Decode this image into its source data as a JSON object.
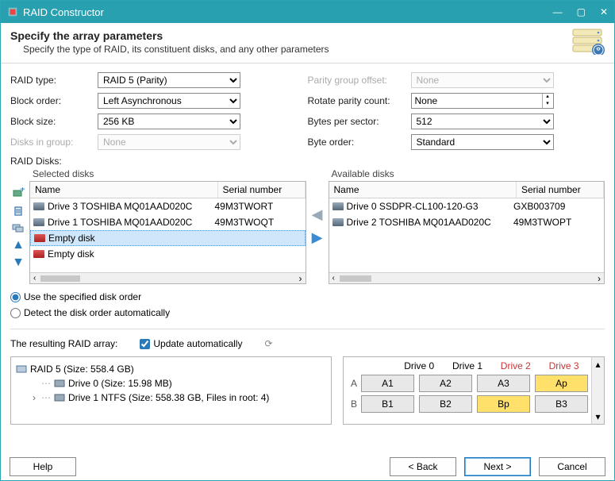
{
  "window": {
    "title": "RAID Constructor"
  },
  "header": {
    "title": "Specify the array parameters",
    "subtitle": "Specify the type of RAID, its constituent disks, and any other parameters"
  },
  "left_form": {
    "raid_type": {
      "label": "RAID type:",
      "value": "RAID 5 (Parity)"
    },
    "block_order": {
      "label": "Block order:",
      "value": "Left Asynchronous"
    },
    "block_size": {
      "label": "Block size:",
      "value": "256 KB"
    },
    "disks_in_group": {
      "label": "Disks in group:",
      "value": "None"
    }
  },
  "right_form": {
    "parity_offset": {
      "label": "Parity group offset:",
      "value": "None"
    },
    "rotate_parity": {
      "label": "Rotate parity count:",
      "value": "None"
    },
    "bytes_sector": {
      "label": "Bytes per sector:",
      "value": "512"
    },
    "byte_order": {
      "label": "Byte order:",
      "value": "Standard"
    }
  },
  "raid_disks_label": "RAID Disks:",
  "selected_title": "Selected disks",
  "available_title": "Available disks",
  "col_name": "Name",
  "col_serial": "Serial number",
  "selected": [
    {
      "name": "Drive 3 TOSHIBA MQ01AAD020C",
      "serial": "49M3TWORT",
      "icon": "disk"
    },
    {
      "name": "Drive 1 TOSHIBA MQ01AAD020C",
      "serial": "49M3TWOQT",
      "icon": "disk"
    },
    {
      "name": "Empty disk",
      "serial": "",
      "icon": "warn"
    },
    {
      "name": "Empty disk",
      "serial": "",
      "icon": "warn"
    }
  ],
  "available": [
    {
      "name": "Drive 0 SSDPR-CL100-120-G3",
      "serial": "GXB003709"
    },
    {
      "name": "Drive 2 TOSHIBA MQ01AAD020C",
      "serial": "49M3TWOPT"
    }
  ],
  "radios": {
    "specified": "Use the specified disk order",
    "auto": "Detect the disk order automatically"
  },
  "result_label": "The resulting RAID array:",
  "update_auto": "Update automatically",
  "tree": {
    "root": "RAID 5 (Size: 558.4 GB)",
    "c1": "Drive 0 (Size: 15.98 MB)",
    "c2": "Drive 1 NTFS (Size: 558.38 GB, Files in root: 4)"
  },
  "matrix": {
    "headers": [
      "Drive 0",
      "Drive 1",
      "Drive 2",
      "Drive 3"
    ],
    "header_red": [
      false,
      false,
      true,
      true
    ],
    "rows": [
      {
        "label": "A",
        "cells": [
          "A1",
          "A2",
          "A3",
          "Ap"
        ],
        "parity": [
          false,
          false,
          false,
          true
        ]
      },
      {
        "label": "B",
        "cells": [
          "B1",
          "B2",
          "Bp",
          "B3"
        ],
        "parity": [
          false,
          false,
          true,
          false
        ]
      }
    ]
  },
  "footer": {
    "help": "Help",
    "back": "< Back",
    "next": "Next >",
    "cancel": "Cancel"
  }
}
